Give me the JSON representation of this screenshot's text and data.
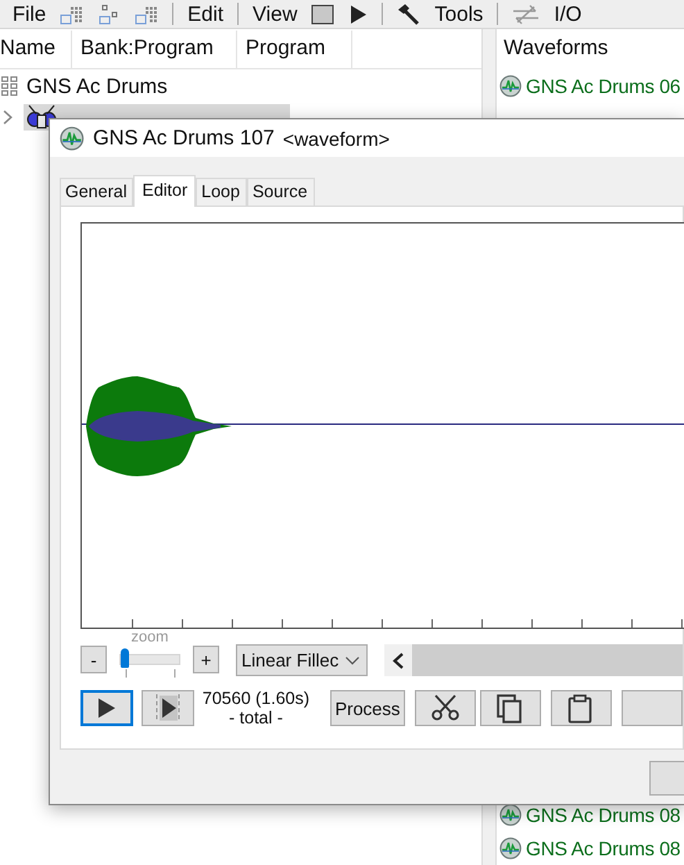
{
  "menu_bar": {
    "file": "File",
    "edit": "Edit",
    "view": "View",
    "tools": "Tools",
    "io": "I/O"
  },
  "tree": {
    "columns": [
      "Name",
      "Bank:Program",
      "Program"
    ],
    "items": [
      {
        "label": "GNS Ac Drums",
        "children": [
          {
            "selected": true,
            "expanded": false
          }
        ]
      }
    ]
  },
  "waveforms": {
    "title": "Waveforms",
    "items_top": [
      "GNS Ac Drums 06"
    ],
    "items_bottom": [
      "GNS Ac Drums 08",
      "GNS Ac Drums 08"
    ]
  },
  "dialog": {
    "title": "GNS Ac Drums 107",
    "title_suffix": "<waveform>",
    "tabs": [
      {
        "label": "General",
        "selected": false
      },
      {
        "label": "Editor",
        "selected": true
      },
      {
        "label": "Loop",
        "selected": false
      },
      {
        "label": "Source",
        "selected": false
      }
    ],
    "editor": {
      "zoom_label": "zoom",
      "zoom_out": "-",
      "zoom_in": "+",
      "zoom": {
        "level": 0
      },
      "mode": "Linear Fillec",
      "transport": [
        {
          "kind": "play",
          "focused": true
        },
        {
          "kind": "play-to-end",
          "focused": false
        }
      ],
      "length": "70560 (1.60s)",
      "length_note": "- total -",
      "process": "Process",
      "tools": [
        {
          "kind": "cut"
        },
        {
          "kind": "copy"
        },
        {
          "kind": "paste"
        },
        {
          "kind": "blank"
        }
      ]
    }
  }
}
